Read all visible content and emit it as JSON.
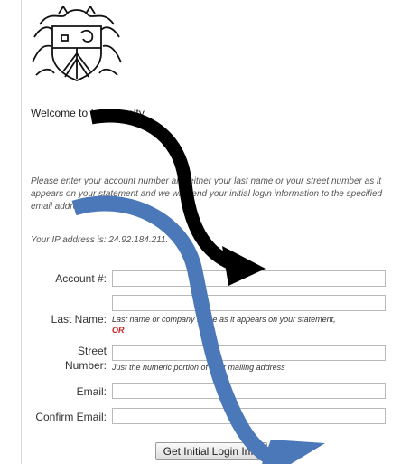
{
  "welcome_text": "Welcome to Ivey Realty",
  "instructions": "Please enter your account number and either your last name or your street number as it appears on your statement and we will send your initial login information to the specified email address.",
  "ip_line": "Your IP address is: 24.92.184.211.",
  "fields": {
    "account": {
      "label": "Account #:",
      "value": ""
    },
    "last_name": {
      "label": "Last Name:",
      "value": "",
      "hint": "Last name or company name as it appears on your statement,",
      "hint_or": "OR"
    },
    "street": {
      "label_line1": "Street",
      "label_line2": "Number:",
      "value": "",
      "hint": "Just the numeric portion of your mailing address"
    },
    "email": {
      "label": "Email:",
      "value": ""
    },
    "confirm_email": {
      "label": "Confirm Email:",
      "value": ""
    }
  },
  "submit_label": "Get Initial Login Info",
  "annotation_colors": {
    "black_arrow": "#000000",
    "blue_arrow": "#4a78b8"
  },
  "icons": {
    "logo": "crest-logo-icon",
    "black_arrow": "black-arrow-icon",
    "blue_arrow": "blue-arrow-icon"
  }
}
